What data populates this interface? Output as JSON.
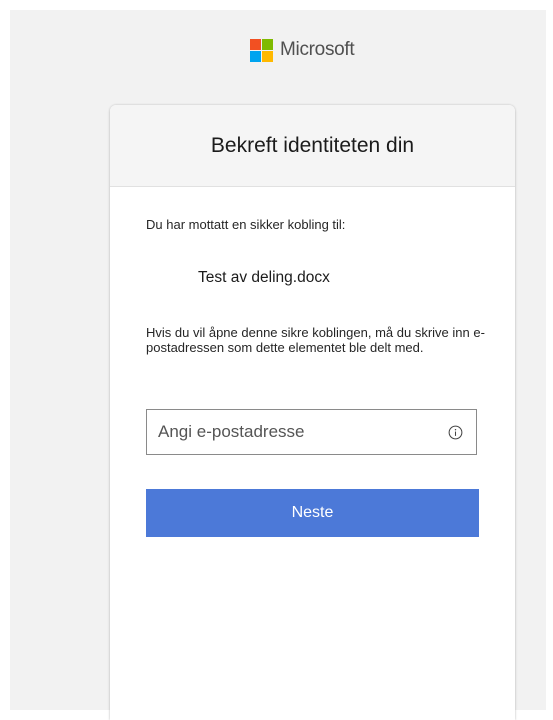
{
  "brand": {
    "name": "Microsoft",
    "logo_colors": [
      "#f25022",
      "#7fba00",
      "#00a4ef",
      "#ffb900"
    ]
  },
  "card": {
    "title": "Bekreft identiteten din",
    "intro_text": "Du har mottatt en sikker kobling til:",
    "file_name": "Test av deling.docx",
    "explanation": "Hvis du vil åpne denne sikre koblingen, må du skrive inn e-postadressen som dette elementet ble delt med.",
    "email_input": {
      "value": "",
      "placeholder": "Angi e-postadresse",
      "info_icon": "info-icon"
    },
    "next_button_label": "Neste",
    "accent_color": "#4c79d8"
  }
}
